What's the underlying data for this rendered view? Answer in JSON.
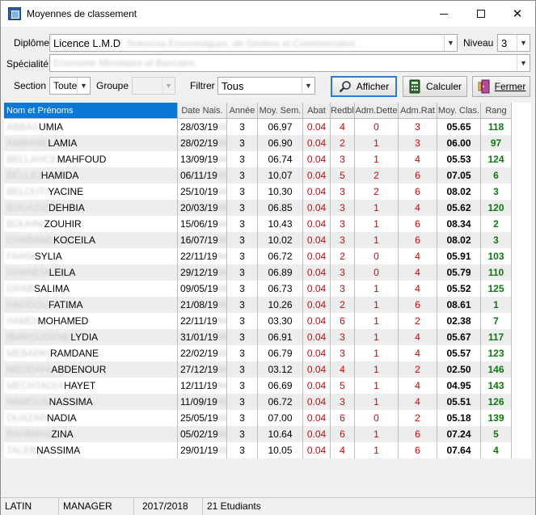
{
  "window": {
    "title": "Moyennes de classement",
    "min_label": "",
    "close_label": "✕"
  },
  "filters": {
    "diplome_label": "Diplôme :",
    "diplome_value": "Licence L.M.D",
    "diplome_hidden": "Sciences Economiques, de Gestion et Commerciales",
    "niveau_label": "Niveau :",
    "niveau_value": "3",
    "specialite_label": "Spécialité :",
    "specialite_hidden": "Economie Monétaire et Bancaire.",
    "section_label": "Section :",
    "section_value": "Toute",
    "groupe_label": "Groupe :",
    "groupe_value": "",
    "filtrer_label": "Filtrer :",
    "filtrer_value": "Tous"
  },
  "buttons": {
    "afficher": "Afficher",
    "calculer": "Calculer",
    "fermer": "Fermer"
  },
  "columns": [
    "Nom et Prénoms",
    "Date Nais.",
    "Année",
    "Moy. Sem.",
    "Abat",
    "Redbl",
    "Adm.Dette",
    "Adm.Rat",
    "Moy. Clas.",
    "Rang"
  ],
  "rows": [
    {
      "nh": "ABBAS",
      "nv": "UMIA",
      "dv": "28/03/19",
      "dh": "95",
      "annee": "3",
      "moy_sem": "06.97",
      "abat": "0.04",
      "redbl": "4",
      "adm_dette": "0",
      "adm_rat": "3",
      "moy_clas": "05.65",
      "rang": "118"
    },
    {
      "nh": "AMRANE",
      "nv": "LAMIA",
      "dv": "28/02/19",
      "dh": "95",
      "annee": "3",
      "moy_sem": "06.90",
      "abat": "0.04",
      "redbl": "2",
      "adm_dette": "1",
      "adm_rat": "3",
      "moy_clas": "06.00",
      "rang": "97"
    },
    {
      "nh": "BELLAHCE",
      "nv": "MAHFOUD",
      "dv": "13/09/19",
      "dh": "94",
      "annee": "3",
      "moy_sem": "06.74",
      "abat": "0.04",
      "redbl": "3",
      "adm_dette": "1",
      "adm_rat": "4",
      "moy_clas": "05.53",
      "rang": "124"
    },
    {
      "nh": "BELLILI",
      "nv": "HAMIDA",
      "dv": "06/11/19",
      "dh": "95",
      "annee": "3",
      "moy_sem": "10.07",
      "abat": "0.04",
      "redbl": "5",
      "adm_dette": "2",
      "adm_rat": "6",
      "moy_clas": "07.05",
      "rang": "6"
    },
    {
      "nh": "BELOUTI",
      "nv": "YACINE",
      "dv": "25/10/19",
      "dh": "94",
      "annee": "3",
      "moy_sem": "10.30",
      "abat": "0.04",
      "redbl": "3",
      "adm_dette": "2",
      "adm_rat": "6",
      "moy_clas": "08.02",
      "rang": "3"
    },
    {
      "nh": "BOUAZIZ",
      "nv": "DEHBIA",
      "dv": "20/03/19",
      "dh": "95",
      "annee": "3",
      "moy_sem": "06.85",
      "abat": "0.04",
      "redbl": "3",
      "adm_dette": "1",
      "adm_rat": "4",
      "moy_clas": "05.62",
      "rang": "120"
    },
    {
      "nh": "BOUHNI",
      "nv": "ZOUHIR",
      "dv": "15/06/19",
      "dh": "94",
      "annee": "3",
      "moy_sem": "10.43",
      "abat": "0.04",
      "redbl": "3",
      "adm_dette": "1",
      "adm_rat": "6",
      "moy_clas": "08.34",
      "rang": "2"
    },
    {
      "nh": "CHABANE",
      "nv": "KOCEILA",
      "dv": "16/07/19",
      "dh": "95",
      "annee": "3",
      "moy_sem": "10.02",
      "abat": "0.04",
      "redbl": "3",
      "adm_dette": "1",
      "adm_rat": "6",
      "moy_clas": "08.02",
      "rang": "3"
    },
    {
      "nh": "FAHSI",
      "nv": "SYLIA",
      "dv": "22/11/19",
      "dh": "94",
      "annee": "3",
      "moy_sem": "06.72",
      "abat": "0.04",
      "redbl": "2",
      "adm_dette": "0",
      "adm_rat": "4",
      "moy_clas": "05.91",
      "rang": "103"
    },
    {
      "nh": "GHANEM",
      "nv": "LEILA",
      "dv": "29/12/19",
      "dh": "94",
      "annee": "3",
      "moy_sem": "06.89",
      "abat": "0.04",
      "redbl": "3",
      "adm_dette": "0",
      "adm_rat": "4",
      "moy_clas": "05.79",
      "rang": "110"
    },
    {
      "nh": "GRAB",
      "nv": "SALIMA",
      "dv": "09/05/19",
      "dh": "95",
      "annee": "3",
      "moy_sem": "06.73",
      "abat": "0.04",
      "redbl": "3",
      "adm_dette": "1",
      "adm_rat": "4",
      "moy_clas": "05.52",
      "rang": "125"
    },
    {
      "nh": "HADDOU",
      "nv": "FATIMA",
      "dv": "21/08/19",
      "dh": "95",
      "annee": "3",
      "moy_sem": "10.26",
      "abat": "0.04",
      "redbl": "2",
      "adm_dette": "1",
      "adm_rat": "6",
      "moy_clas": "08.61",
      "rang": "1"
    },
    {
      "nh": "HAMDI",
      "nv": "MOHAMED",
      "dv": "22/11/19",
      "dh": "94",
      "annee": "3",
      "moy_sem": "03.30",
      "abat": "0.04",
      "redbl": "6",
      "adm_dette": "1",
      "adm_rat": "2",
      "moy_clas": "02.38",
      "rang": "7"
    },
    {
      "nh": "IBAROUDENE",
      "nv": "LYDIA",
      "dv": "31/01/19",
      "dh": "95",
      "annee": "3",
      "moy_sem": "06.91",
      "abat": "0.04",
      "redbl": "3",
      "adm_dette": "1",
      "adm_rat": "4",
      "moy_clas": "05.67",
      "rang": "117"
    },
    {
      "nh": "MEBARKI",
      "nv": "RAMDANE",
      "dv": "22/02/19",
      "dh": "95",
      "annee": "3",
      "moy_sem": "06.79",
      "abat": "0.04",
      "redbl": "3",
      "adm_dette": "1",
      "adm_rat": "4",
      "moy_clas": "05.57",
      "rang": "123"
    },
    {
      "nh": "MEDDAHI",
      "nv": "ABDENOUR",
      "dv": "27/12/19",
      "dh": "94",
      "annee": "3",
      "moy_sem": "03.12",
      "abat": "0.04",
      "redbl": "4",
      "adm_dette": "1",
      "adm_rat": "2",
      "moy_clas": "02.50",
      "rang": "146"
    },
    {
      "nh": "MECHTAOUI",
      "nv": "HAYET",
      "dv": "12/11/19",
      "dh": "94",
      "annee": "3",
      "moy_sem": "06.69",
      "abat": "0.04",
      "redbl": "5",
      "adm_dette": "1",
      "adm_rat": "4",
      "moy_clas": "04.95",
      "rang": "143"
    },
    {
      "nh": "NAMOUS",
      "nv": "NASSIMA",
      "dv": "11/09/19",
      "dh": "95",
      "annee": "3",
      "moy_sem": "06.72",
      "abat": "0.04",
      "redbl": "3",
      "adm_dette": "1",
      "adm_rat": "4",
      "moy_clas": "05.51",
      "rang": "126"
    },
    {
      "nh": "OUAZAR",
      "nv": "NADIA",
      "dv": "25/05/19",
      "dh": "95",
      "annee": "3",
      "moy_sem": "07.00",
      "abat": "0.04",
      "redbl": "6",
      "adm_dette": "0",
      "adm_rat": "2",
      "moy_clas": "05.18",
      "rang": "139"
    },
    {
      "nh": "RAHMANI",
      "nv": "ZINA",
      "dv": "05/02/19",
      "dh": "95",
      "annee": "3",
      "moy_sem": "10.64",
      "abat": "0.04",
      "redbl": "6",
      "adm_dette": "1",
      "adm_rat": "6",
      "moy_clas": "07.24",
      "rang": "5"
    },
    {
      "nh": "TALEB",
      "nv": "NASSIMA",
      "dv": "29/01/19",
      "dh": "95",
      "annee": "3",
      "moy_sem": "10.05",
      "abat": "0.04",
      "redbl": "4",
      "adm_dette": "1",
      "adm_rat": "6",
      "moy_clas": "07.64",
      "rang": "4"
    }
  ],
  "status": {
    "lang": "LATIN",
    "user": "MANAGER",
    "year": "2017/2018",
    "count": "21 Etudiants"
  },
  "colors": {
    "selection": "#0a78d7",
    "red_values": "#e00000",
    "rank_green": "#0b7b0b"
  }
}
